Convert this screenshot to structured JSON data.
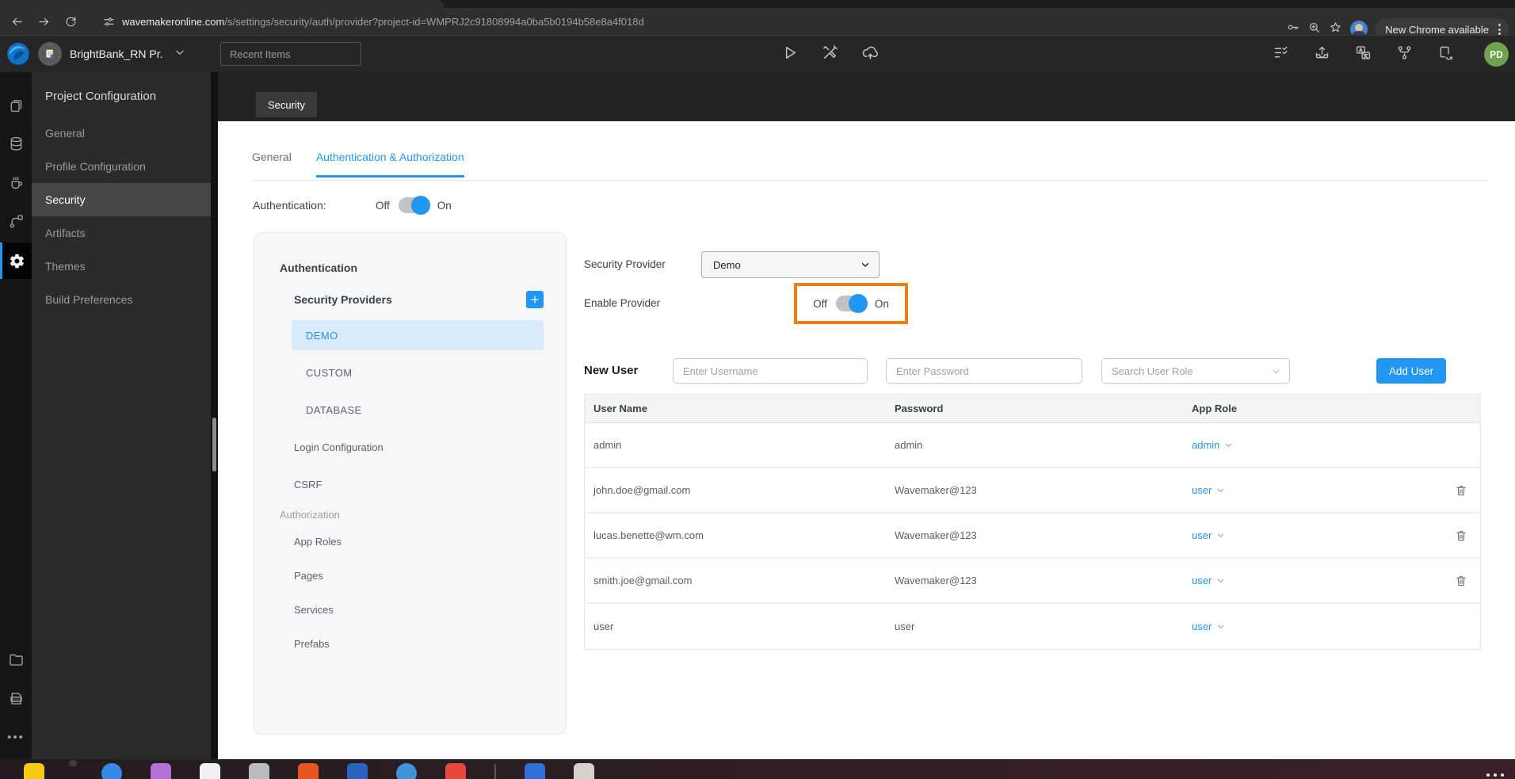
{
  "colors": {
    "accent_blue": "#2196f3",
    "highlight_orange": "#f07c12",
    "demo_bg": "#d9eafb",
    "toggle_track": "#c2c2c2",
    "avatar_green": "#71a24f"
  },
  "browser": {
    "url_host": "wavemakeronline.com",
    "url_path": "/s/settings/security/auth/provider?project-id=WMPRJ2c91808994a0ba5b0194b58e8a4f018d",
    "update_pill_label": "New Chrome available"
  },
  "app_bar": {
    "project_name": "BrightBank_RN Pr...",
    "recent_items_label": "Recent Items",
    "user_initials": "PD"
  },
  "config_panel": {
    "title": "Project Configuration",
    "items": [
      {
        "label": "General",
        "active": false
      },
      {
        "label": "Profile Configuration",
        "active": false
      },
      {
        "label": "Security",
        "active": true
      },
      {
        "label": "Artifacts",
        "active": false
      },
      {
        "label": "Themes",
        "active": false
      },
      {
        "label": "Build Preferences",
        "active": false
      }
    ]
  },
  "page": {
    "header_tab": "Security",
    "tabs": [
      {
        "label": "General",
        "active": false
      },
      {
        "label": "Authentication & Authorization",
        "active": true
      }
    ],
    "authentication_label": "Authentication:",
    "authentication_toggle": {
      "off": "Off",
      "on": "On",
      "state": "on"
    }
  },
  "auth_nav": {
    "section_authentication": "Authentication",
    "security_providers_label": "Security Providers",
    "providers": [
      {
        "label": "DEMO",
        "selected": true
      },
      {
        "label": "CUSTOM",
        "selected": false
      },
      {
        "label": "DATABASE",
        "selected": false
      }
    ],
    "links": [
      "Login Configuration",
      "CSRF"
    ],
    "section_authorization": "Authorization",
    "authorization_links": [
      "App Roles",
      "Pages",
      "Services",
      "Prefabs"
    ]
  },
  "provider": {
    "security_provider_label": "Security Provider",
    "selected_provider": "Demo",
    "enable_provider_label": "Enable Provider",
    "enable_toggle": {
      "off": "Off",
      "on": "On",
      "state": "on"
    }
  },
  "new_user": {
    "label": "New User",
    "username_placeholder": "Enter Username",
    "password_placeholder": "Enter Password",
    "role_placeholder": "Search User Role",
    "add_button_label": "Add User"
  },
  "users_table": {
    "columns": [
      "User Name",
      "Password",
      "App Role"
    ],
    "rows": [
      {
        "username": "admin",
        "password": "admin",
        "role": "admin",
        "deletable": false
      },
      {
        "username": "john.doe@gmail.com",
        "password": "Wavemaker@123",
        "role": "user",
        "deletable": true
      },
      {
        "username": "lucas.benette@wm.com",
        "password": "Wavemaker@123",
        "role": "user",
        "deletable": true
      },
      {
        "username": "smith.joe@gmail.com",
        "password": "Wavemaker@123",
        "role": "user",
        "deletable": true
      },
      {
        "username": "user",
        "password": "user",
        "role": "user",
        "deletable": false
      }
    ]
  },
  "taskbar": {
    "apps": [
      {
        "name": "gimp",
        "color": "#f6c915",
        "shape": "square"
      },
      {
        "name": "chrome",
        "color": "#e94335",
        "shape": "circle",
        "active": true
      },
      {
        "name": "thunderbird",
        "color": "#3689e6",
        "shape": "circle"
      },
      {
        "name": "files",
        "color": "#b470d6",
        "shape": "square"
      },
      {
        "name": "text-editor",
        "color": "#eef0f2",
        "shape": "square"
      },
      {
        "name": "rhythmbox",
        "color": "#b8bcc0",
        "shape": "square"
      },
      {
        "name": "ubuntu-software",
        "color": "#e95420",
        "shape": "square"
      },
      {
        "name": "writer",
        "color": "#2b63c0",
        "shape": "square"
      },
      {
        "name": "help",
        "color": "#4193d8",
        "shape": "circle"
      },
      {
        "name": "mail",
        "color": "#e5483d",
        "shape": "square"
      },
      {
        "name": "divider",
        "shape": "divider"
      },
      {
        "name": "builder",
        "color": "#3170d8",
        "shape": "square"
      },
      {
        "name": "archive-manager",
        "color": "#d6d2cb",
        "shape": "square"
      }
    ]
  }
}
